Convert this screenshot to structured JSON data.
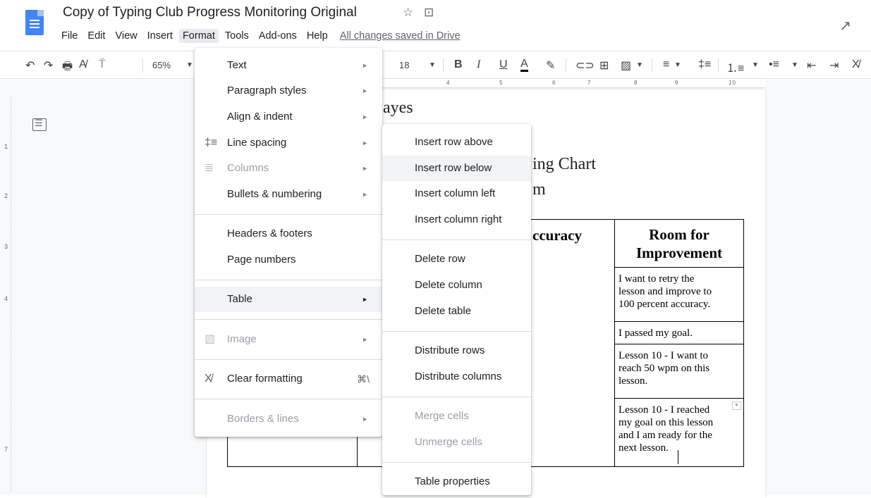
{
  "app": {
    "doc_title": "Copy of Typing Club Progress Monitoring Original",
    "saved_status": "All changes saved in Drive",
    "menus": [
      "File",
      "Edit",
      "View",
      "Insert",
      "Format",
      "Tools",
      "Add-ons",
      "Help"
    ],
    "active_menu": "Format",
    "icons": {
      "star": "☆",
      "move": "⊡",
      "trend": "↗"
    }
  },
  "toolbar": {
    "zoom": "65%",
    "font_size": "18",
    "bold": "B",
    "italic": "I",
    "underline": "U",
    "text_color": "A"
  },
  "ruler": {
    "h_numbers": [
      "4",
      "5",
      "6",
      "7",
      "8",
      "9",
      "10"
    ],
    "v_numbers": [
      "1",
      "2",
      "3",
      "4",
      "7"
    ]
  },
  "document": {
    "text_fragments": [
      "ayes",
      "ing Chart",
      "m"
    ],
    "table": {
      "headers": [
        "ccuracy",
        "Room for\nImprovement"
      ],
      "room_for_improvement": [
        "I want to retry the\nlesson and improve to\n100 percent accuracy.",
        "I passed my goal.",
        "Lesson 10 - I want to\nreach 50 wpm on this\nlesson.",
        "Lesson 10 - I reached\nmy goal on this lesson\nand I am ready for the\nnext lesson."
      ]
    }
  },
  "format_menu": {
    "items": [
      {
        "label": "Text",
        "arrow": "►",
        "disabled": false
      },
      {
        "label": "Paragraph styles",
        "arrow": "►",
        "disabled": false
      },
      {
        "label": "Align & indent",
        "arrow": "►",
        "disabled": false
      },
      {
        "label": "Line spacing",
        "arrow": "►",
        "disabled": false,
        "icon": "‡≡"
      },
      {
        "label": "Columns",
        "arrow": "►",
        "disabled": true,
        "icon": "≣"
      },
      {
        "label": "Bullets & numbering",
        "arrow": "►",
        "disabled": false
      },
      {
        "label": "Headers & footers",
        "disabled": false
      },
      {
        "label": "Page numbers",
        "disabled": false
      },
      {
        "label": "Table",
        "arrow": "►",
        "disabled": false,
        "highlighted": true
      },
      {
        "label": "Image",
        "arrow": "►",
        "disabled": true,
        "icon": "▧"
      },
      {
        "label": "Clear formatting",
        "shortcut": "⌘\\",
        "disabled": false,
        "icon": "X̸"
      },
      {
        "label": "Borders & lines",
        "arrow": "►",
        "disabled": true
      }
    ]
  },
  "table_submenu": {
    "items": [
      {
        "label": "Insert row above",
        "disabled": false
      },
      {
        "label": "Insert row below",
        "disabled": false,
        "highlighted": true
      },
      {
        "label": "Insert column left",
        "disabled": false
      },
      {
        "label": "Insert column right",
        "disabled": false
      },
      {
        "label": "Delete row",
        "disabled": false
      },
      {
        "label": "Delete column",
        "disabled": false
      },
      {
        "label": "Delete table",
        "disabled": false
      },
      {
        "label": "Distribute rows",
        "disabled": false
      },
      {
        "label": "Distribute columns",
        "disabled": false
      },
      {
        "label": "Merge cells",
        "disabled": true
      },
      {
        "label": "Unmerge cells",
        "disabled": true
      },
      {
        "label": "Table properties",
        "disabled": false
      }
    ]
  }
}
